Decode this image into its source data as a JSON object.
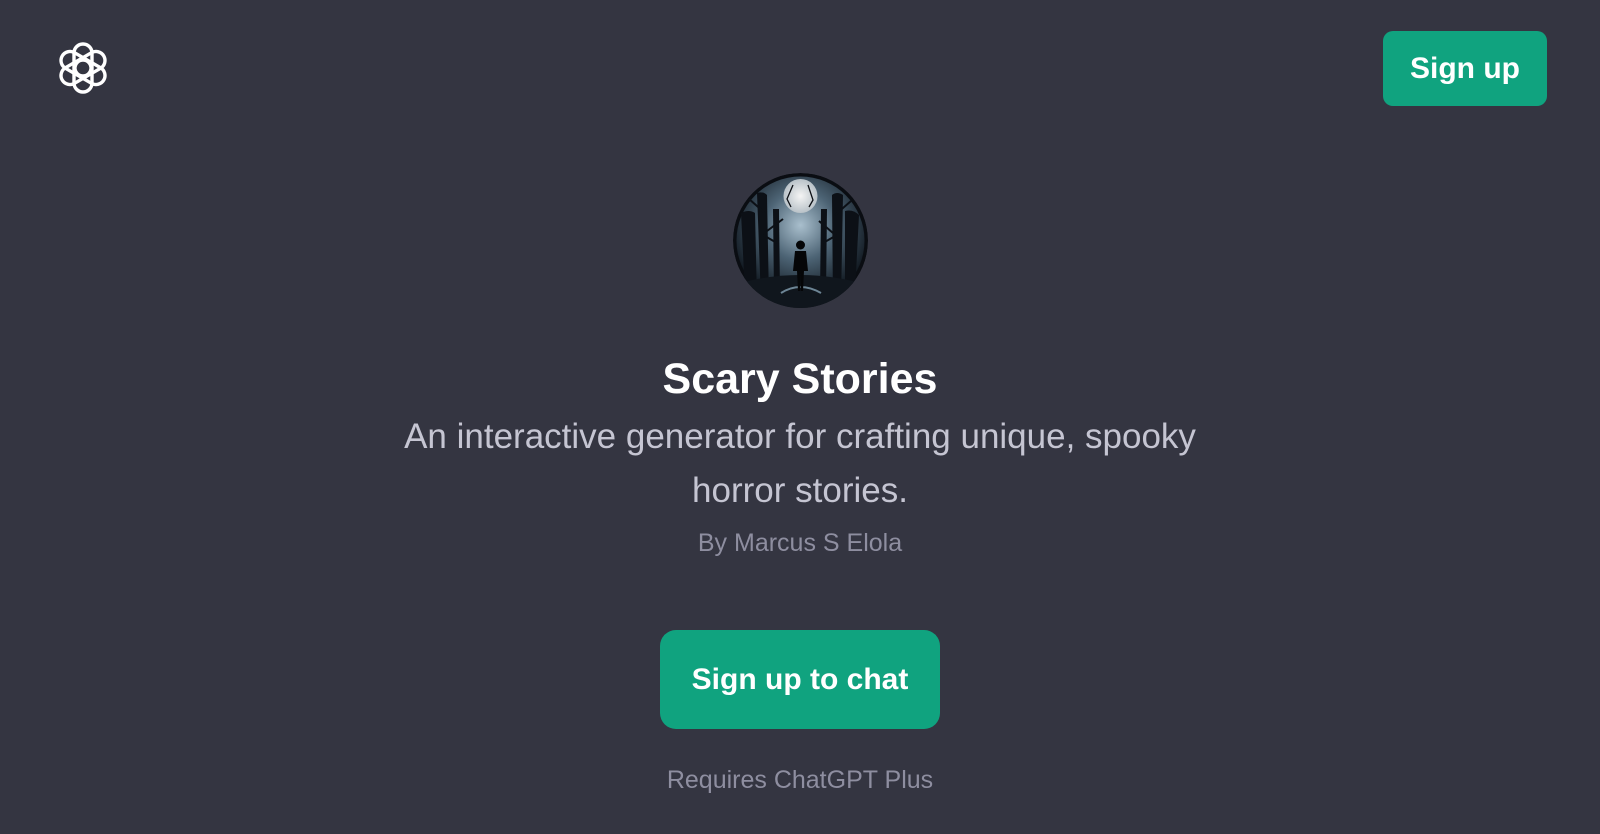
{
  "header": {
    "logo_icon": "openai-logo-icon",
    "signup_label": "Sign up"
  },
  "gpt": {
    "avatar_icon": "haunted-forest-moon-avatar",
    "name": "Scary Stories",
    "description": "An interactive generator for crafting unique, spooky horror stories.",
    "author": "By Marcus S Elola"
  },
  "cta": {
    "label": "Sign up to chat",
    "requirement": "Requires ChatGPT Plus"
  },
  "colors": {
    "background": "#343541",
    "accent": "#10a37f",
    "title": "#ffffff",
    "description": "#c5c5d2",
    "muted": "#8e8ea0"
  }
}
